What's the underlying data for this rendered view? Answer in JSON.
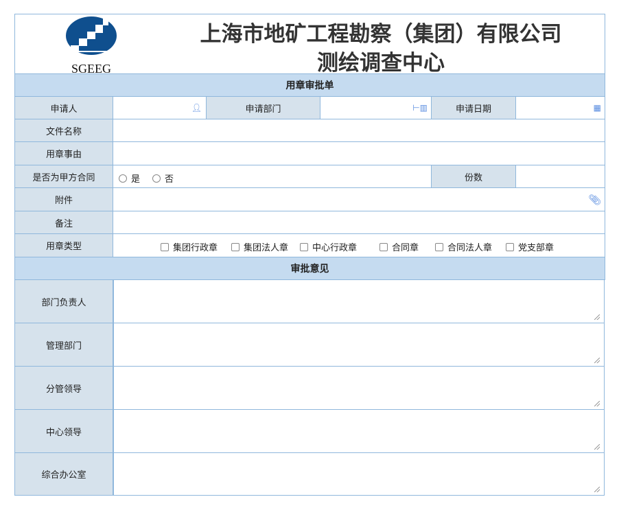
{
  "header": {
    "logo_text": "SGEEG",
    "title_line1": "上海市地矿工程勘察（集团）有限公司",
    "title_line2": "测绘调查中心"
  },
  "form": {
    "section1": "用章审批单",
    "applicant": "申请人",
    "department": "申请部门",
    "date": "申请日期",
    "file_name": "文件名称",
    "reason": "用章事由",
    "is_party_a": "是否为甲方合同",
    "yes": "是",
    "no": "否",
    "copies": "份数",
    "attachment": "附件",
    "remark": "备注",
    "seal_type": "用章类型",
    "seal_options": [
      "集团行政章",
      "集团法人章",
      "中心行政章",
      "合同章",
      "合同法人章",
      "党支部章"
    ]
  },
  "approval": {
    "section2": "审批意见",
    "rows": [
      "部门负责人",
      "管理部门",
      "分管领导",
      "中心领导",
      "综合办公室"
    ]
  }
}
